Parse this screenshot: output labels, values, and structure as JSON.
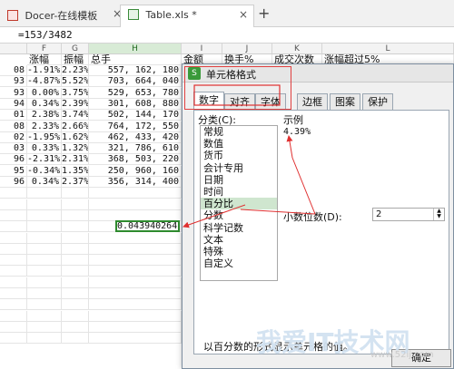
{
  "tabs": [
    {
      "label": "Docer-在线模板",
      "close": "×"
    },
    {
      "label": "Table.xls *",
      "close": "×"
    }
  ],
  "new_tab": "+",
  "formula": "=153/3482",
  "columns": [
    {
      "id": "F"
    },
    {
      "id": "G"
    },
    {
      "id": "H"
    },
    {
      "id": "I"
    },
    {
      "id": "J"
    },
    {
      "id": "K"
    },
    {
      "id": "L"
    }
  ],
  "headers": [
    "涨幅",
    "振幅",
    "总手",
    "金额",
    "换手%",
    "成交次数",
    "涨幅超过5%"
  ],
  "rows": [
    {
      "a": "08",
      "f": "-1.91%",
      "g": "2.23%",
      "h": "557, 162, 180"
    },
    {
      "a": "93",
      "f": "-4.87%",
      "g": "5.52%",
      "h": "703, 664, 040"
    },
    {
      "a": "93",
      "f": "0.00%",
      "g": "3.75%",
      "h": "529, 653, 780"
    },
    {
      "a": "94",
      "f": "0.34%",
      "g": "2.39%",
      "h": "301, 608, 880"
    },
    {
      "a": "01",
      "f": "2.38%",
      "g": "3.74%",
      "h": "502, 144, 170"
    },
    {
      "a": "08",
      "f": "2.33%",
      "g": "2.66%",
      "h": "764, 172, 550"
    },
    {
      "a": "02",
      "f": "-1.95%",
      "g": "1.62%",
      "h": "462, 433, 420"
    },
    {
      "a": "03",
      "f": "0.33%",
      "g": "1.32%",
      "h": "321, 786, 610"
    },
    {
      "a": "96",
      "f": "-2.31%",
      "g": "2.31%",
      "h": "368, 503, 220"
    },
    {
      "a": "95",
      "f": "-0.34%",
      "g": "1.35%",
      "h": "250, 960, 160"
    },
    {
      "a": "96",
      "f": "0.34%",
      "g": "2.37%",
      "h": "356, 314, 400"
    }
  ],
  "selected_value": "0.043940264",
  "dialog": {
    "title": "单元格格式",
    "tabs": [
      "数字",
      "对齐",
      "字体",
      "边框",
      "图案",
      "保护"
    ],
    "category_label": "分类(C):",
    "categories": [
      "常规",
      "数值",
      "货币",
      "会计专用",
      "日期",
      "时间",
      "百分比",
      "分数",
      "科学记数",
      "文本",
      "特殊",
      "自定义"
    ],
    "selected_category": "百分比",
    "sample_label": "示例",
    "sample_value": "4.39%",
    "decimal_label": "小数位数(D):",
    "decimal_value": "2",
    "description": "以百分数的形式显示单元格的值。",
    "ok": "确定"
  },
  "watermark": {
    "main": "我爱IT技术网",
    "url": "www.52ij.com"
  }
}
